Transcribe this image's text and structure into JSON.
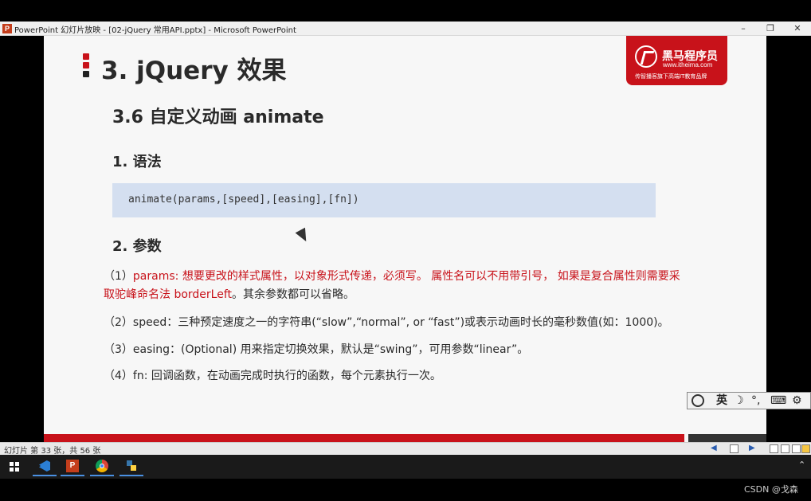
{
  "window": {
    "app_icon_letter": "P",
    "title": "PowerPoint 幻灯片放映 - [02-jQuery 常用API.pptx] - Microsoft PowerPoint",
    "minimize": "–",
    "restore": "❐",
    "close": "✕"
  },
  "slide": {
    "title": "3. jQuery 效果",
    "logo": {
      "name": "黑马程序员",
      "url": "www.itheima.com",
      "slogan": "传智播客旗下高端IT教育品牌"
    },
    "subtitle": "3.6  自定义动画 animate",
    "section1": "1. 语法",
    "code": "animate(params,[speed],[easing],[fn])",
    "section2": "2. 参数",
    "params": {
      "p1_prefix": "（1）",
      "p1_red_1": "params: 想要更改的样式属性，以对象形式传递，必须写。 属性名可以不用带引号， 如果是复合属性则需要采",
      "p1_red_2": "取驼峰命名法 borderLeft",
      "p1_tail": "。其余参数都可以省略。",
      "p2": "（2）speed：三种预定速度之一的字符串(“slow”,“normal”, or  “fast”)或表示动画时长的毫秒数值(如：1000)。",
      "p3": "（3）easing：(Optional) 用来指定切换效果，默认是“swing”，可用参数“linear”。",
      "p4": "（4）fn:  回调函数，在动画完成时执行的函数，每个元素执行一次。"
    }
  },
  "ime": {
    "mode": "英",
    "moon": "☽",
    "punct": "°,",
    "keyboard": "⌨",
    "settings": "⚙"
  },
  "statusbar": {
    "text": "幻灯片 第 33 张，共 56 张"
  },
  "taskbar": {
    "apps": [
      "vscode-icon",
      "powerpoint-icon",
      "chrome-icon",
      "python-icon"
    ]
  },
  "watermark": "CSDN @戈森"
}
